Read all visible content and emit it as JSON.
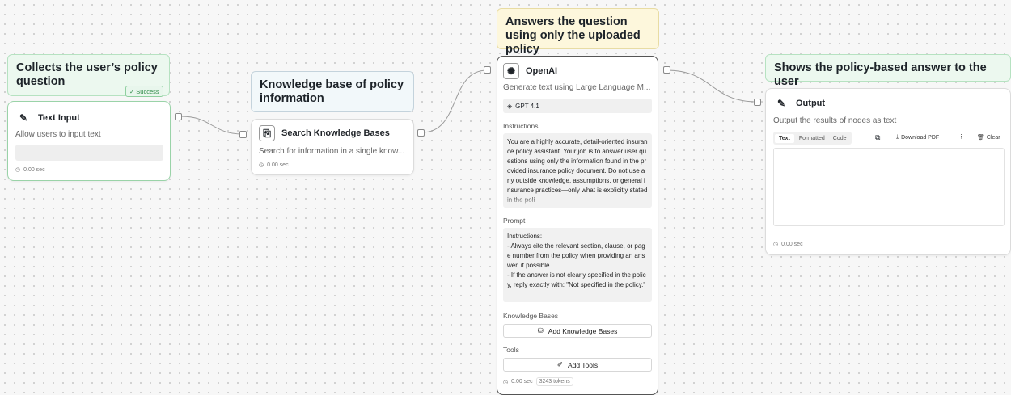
{
  "notes": {
    "collect": "Collects the user’s policy question",
    "knowledge": "Knowledge base of policy information",
    "answers": "Answers the question using only the uploaded policy",
    "shows": "Shows the policy-based answer to the user"
  },
  "text_input_node": {
    "badge": "Success",
    "title": "Text Input",
    "description": "Allow users to input text",
    "time": "0.00 sec"
  },
  "search_node": {
    "title": "Search Knowledge Bases",
    "description": "Search for information in a single know...",
    "time": "0.00 sec"
  },
  "openai_node": {
    "title": "OpenAI",
    "description": "Generate text using Large Language M...",
    "model": "GPT 4.1",
    "instructions_label": "Instructions",
    "instructions_text": "You are a highly accurate, detail-oriented insurance policy assistant. Your job is to answer user questions using only the information found in the provided insurance policy document. Do not use any outside knowledge, assumptions, or general insurance practices—only what is explicitly stated in the poli",
    "prompt_label": "Prompt",
    "prompt_text": "Instructions:\n- Always cite the relevant section, clause, or page number from the policy when providing an answer, if possible.\n- If the answer is not clearly specified in the policy, reply exactly with: \"Not specified in the policy.\"",
    "kb_label": "Knowledge Bases",
    "kb_button": "Add Knowledge Bases",
    "tools_label": "Tools",
    "tools_button": "Add Tools",
    "time": "0.00 sec",
    "tokens": "3243 tokens"
  },
  "output_node": {
    "title": "Output",
    "description": "Output the results of nodes as text",
    "tabs": [
      "Text",
      "Formatted",
      "Code"
    ],
    "download": "Download PDF",
    "more": "⋮",
    "clear": "Clear",
    "time": "0.00 sec"
  }
}
